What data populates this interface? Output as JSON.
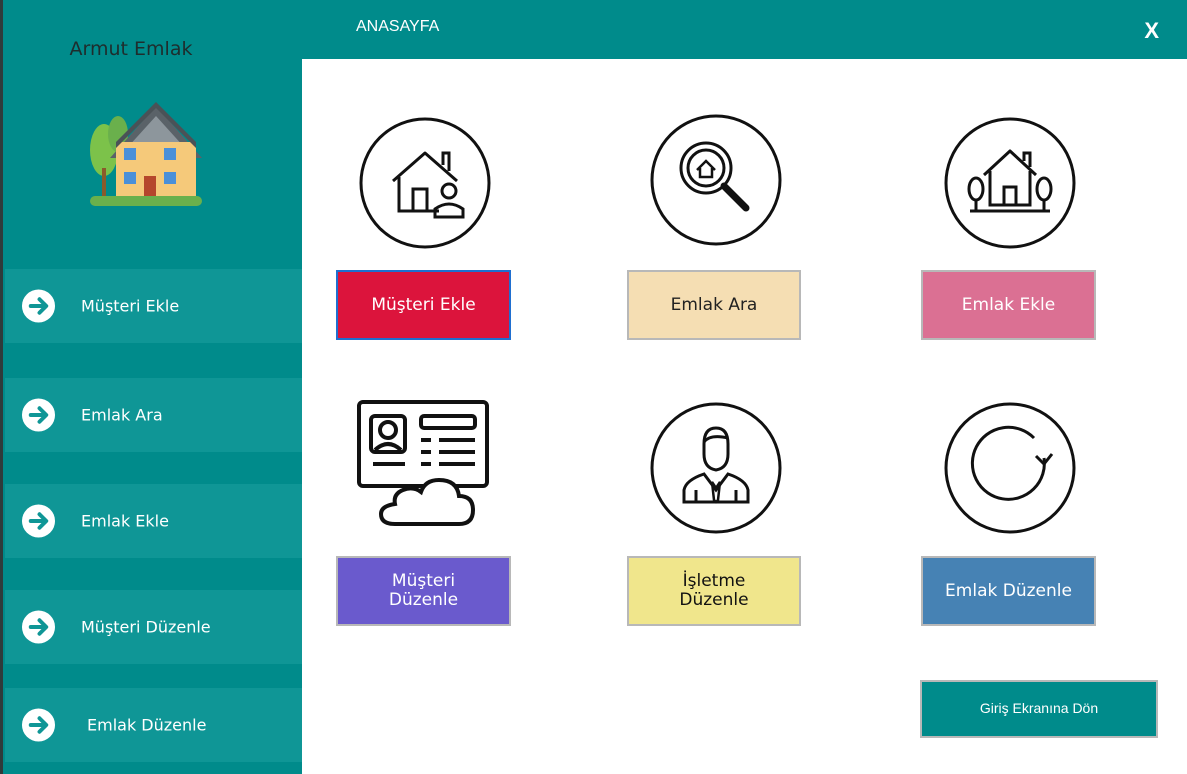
{
  "app": {
    "title": "Armut Emlak"
  },
  "header": {
    "title": "ANASAYFA",
    "close_label": "X"
  },
  "sidebar": {
    "items": [
      {
        "label": "Müşteri Ekle"
      },
      {
        "label": "Emlak Ara"
      },
      {
        "label": "Emlak Ekle"
      },
      {
        "label": "Müşteri Düzenle"
      },
      {
        "label": "Emlak Düzenle"
      }
    ]
  },
  "main": {
    "musteri_ekle": {
      "label": "Müşteri Ekle",
      "color": "#dc143c"
    },
    "emlak_ara": {
      "label": "Emlak Ara",
      "color": "#f5deb3"
    },
    "emlak_ekle": {
      "label": "Emlak Ekle",
      "color": "#db7093"
    },
    "musteri_duzenle": {
      "line1": "Müşteri",
      "line2": "Düzenle",
      "color": "#6a5acd"
    },
    "isletme_duzenle": {
      "line1": "İşletme",
      "line2": "Düzenle",
      "color": "#f0e68c"
    },
    "emlak_duzenle": {
      "label": "Emlak Düzenle",
      "color": "#4682b4"
    },
    "giris_donus": {
      "label": "Giriş Ekranına Dön",
      "color": "#008b8b"
    }
  },
  "icons": [
    "house-logo-icon",
    "house-user-icon",
    "search-house-icon",
    "house-trees-icon",
    "profile-card-cloud-icon",
    "businessman-icon",
    "refresh-icon",
    "arrow-right-circle-icon"
  ]
}
